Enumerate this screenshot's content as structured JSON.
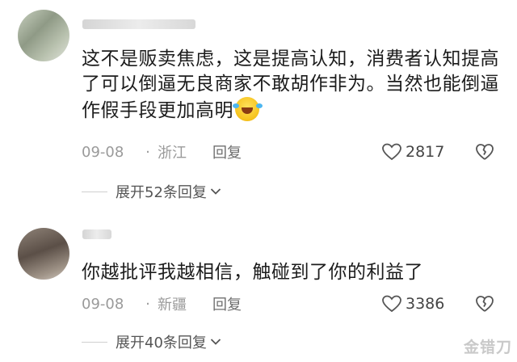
{
  "comments": [
    {
      "text": "这不是贩卖焦虑，这是提高认知，消费者认知提高了可以倒逼无良商家不敢胡作非为。当然也能倒逼作假手段更加高明",
      "emoji_icon": "rolling-laughing-emoji",
      "date": "09-08",
      "separator": "·",
      "location": "浙江",
      "reply_label": "回复",
      "likes": "2817",
      "expand_label": "展开52条回复"
    },
    {
      "text": "你越批评我越相信，触碰到了你的利益了",
      "date": "09-08",
      "separator": "·",
      "location": "新疆",
      "reply_label": "回复",
      "likes": "3386",
      "expand_label": "展开40条回复"
    }
  ],
  "watermark": "金错刀",
  "colors": {
    "text": "#1c1c1c",
    "meta": "#9a9a9a",
    "icon": "#555555"
  }
}
